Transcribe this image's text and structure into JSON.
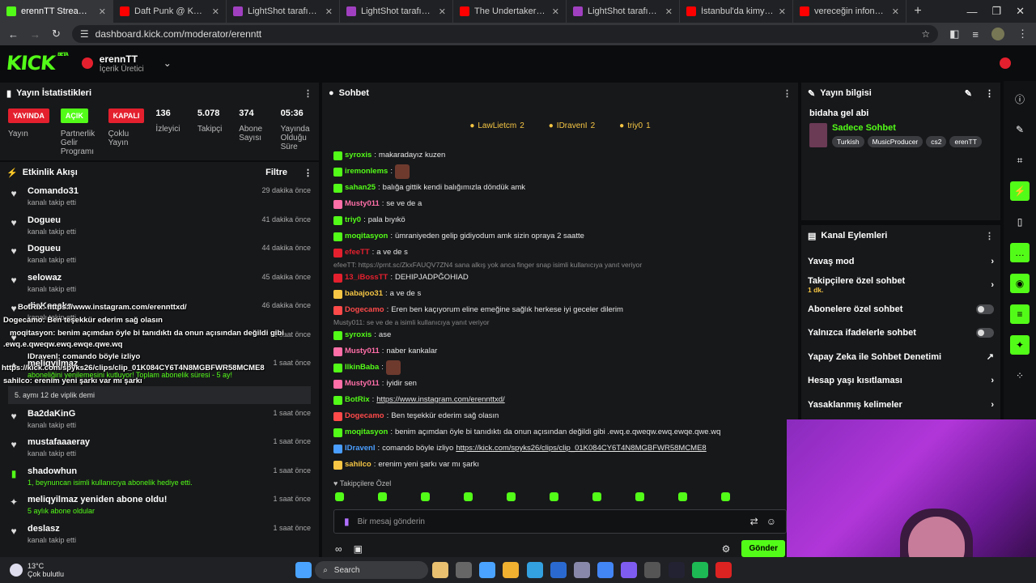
{
  "browser": {
    "tabs": [
      {
        "title": "erennTT Stream - Kick Da",
        "color": "#53fc18",
        "active": true
      },
      {
        "title": "Daft Punk @ Kuruçeşme A",
        "color": "#ff0000"
      },
      {
        "title": "LightShot tarafından Ekra",
        "color": "#a040c0"
      },
      {
        "title": "LightShot tarafından Ekra",
        "color": "#a040c0"
      },
      {
        "title": "The Undertaker appears f",
        "color": "#ff0000"
      },
      {
        "title": "LightShot tarafından Ekra",
        "color": "#a040c0"
      },
      {
        "title": "İstanbul'da kimyasal mad",
        "color": "#ff0000"
      },
      {
        "title": "vereceğin infonun ta a*m",
        "color": "#ff0000"
      }
    ],
    "url": "dashboard.kick.com/moderator/erenntt"
  },
  "header": {
    "logo": "KICK",
    "logo_sup": "BETA",
    "channel": "erennTT",
    "role": "İçerik Üretici"
  },
  "stats": {
    "title": "Yayın İstatistikleri",
    "items": [
      {
        "badge": "YAYINDA",
        "badge_color": "#e4202e",
        "label": "Yayın"
      },
      {
        "badge": "AÇIK",
        "badge_color": "#53fc18",
        "label": "Partnerlik Gelir Programı"
      },
      {
        "badge": "KAPALI",
        "badge_color": "#e4202e",
        "label": "Çoklu Yayın"
      },
      {
        "value": "136",
        "label": "İzleyici"
      },
      {
        "value": "5.078",
        "label": "Takipçi"
      },
      {
        "value": "374",
        "label": "Abone Sayısı"
      },
      {
        "value": "05:36",
        "label": "Yayında Olduğu Süre"
      }
    ]
  },
  "feed": {
    "title": "Etkinlik Akışı",
    "filter": "Filtre",
    "items": [
      {
        "name": "Comando31",
        "sub": "kanalı takip etti",
        "time": "29 dakika önce",
        "icon": "heart"
      },
      {
        "name": "Dogueu",
        "sub": "kanalı takip etti",
        "time": "41 dakika önce",
        "icon": "heart"
      },
      {
        "name": "Dogueu",
        "sub": "kanalı takip etti",
        "time": "44 dakika önce",
        "icon": "heart"
      },
      {
        "name": "selowaz",
        "sub": "kanalı takip etti",
        "time": "45 dakika önce",
        "icon": "heart"
      },
      {
        "name": "dieKocaks",
        "sub": "kanalı takip etti",
        "time": "46 dakika önce",
        "icon": "heart"
      },
      {
        "name": "",
        "sub": "",
        "time": "1 saat önce",
        "icon": "heart"
      },
      {
        "name": "meliqyilmaz",
        "sub": "aboneliğini yenilemesini kutluyor! Toplam abonelik süresi - 5 ay!",
        "time": "1 saat önce",
        "icon": "star"
      },
      {
        "name": "Ba2daKinG",
        "sub": "kanalı takip etti",
        "time": "1 saat önce",
        "icon": "heart"
      },
      {
        "name": "mustafaaaeray",
        "sub": "kanalı takip etti",
        "time": "1 saat önce",
        "icon": "heart"
      },
      {
        "name": "shadowhun",
        "sub": "1, beynuncan isimli kullanıcıya abonelik hediye etti.",
        "time": "1 saat önce",
        "icon": "gift"
      },
      {
        "name": "meliqyilmaz yeniden abone oldu!",
        "sub": "5 aylık abone oldular",
        "time": "1 saat önce",
        "icon": "star"
      },
      {
        "name": "deslasz",
        "sub": "kanalı takip etti",
        "time": "1 saat önce",
        "icon": "heart"
      }
    ],
    "gift_msg": "5. aymı 12 de viplik demi"
  },
  "overlay": [
    {
      "text": "BotRix: https://www.instagram.com/erennttxd/",
      "color": "#ffffff"
    },
    {
      "text": "Dogecamo: Ben teşekkür ederim sağ olasın",
      "color": "#ffffff"
    },
    {
      "text": "moqitasyon: benim açımdan öyle bi tanıdıktı da onun açısından değildi gibi",
      "color": "#ffffff"
    },
    {
      "text": ".ewq.e.qweqw.ewq.ewqe.qwe.wq",
      "color": "#ffffff"
    },
    {
      "text": "IDravenI: comando böyle izliyo",
      "color": "#ffffff"
    },
    {
      "text": "https://kick.com/spyks26/clips/clip_01K084CY6T4N8MGBFWR58MCME8",
      "color": "#ffffff"
    },
    {
      "text": "sahilco: erenim yeni şarkı var mı şarkı",
      "color": "#ffffff"
    }
  ],
  "chat": {
    "title": "Sohbet",
    "top": [
      {
        "name": "LawLietcm",
        "count": "2"
      },
      {
        "name": "IDravenI",
        "count": "2"
      },
      {
        "name": "triy0",
        "count": "1"
      }
    ],
    "messages": [
      {
        "user": "syroxis",
        "color": "#53fc18",
        "text": "makaradayız kuzen"
      },
      {
        "user": "iremonlems",
        "color": "#53fc18",
        "text": "",
        "emote": true
      },
      {
        "user": "sahan25",
        "color": "#53fc18",
        "text": "balığa gittik kendi balığımızla döndük amk"
      },
      {
        "user": "Musty011",
        "color": "#ff6fa8",
        "text": "se ve de a"
      },
      {
        "user": "triy0",
        "color": "#53fc18",
        "text": "pala bıyıkö"
      },
      {
        "user": "moqitasyon",
        "color": "#53fc18",
        "text": "ümraniyeden gelip gidiyodum amk sizin opraya 2 saatte"
      },
      {
        "user": "efeeTT",
        "color": "#e4202e",
        "text": "a ve de s"
      },
      {
        "reply": "efeeTT: https://prnt.sc/ZkxFAUQV7ZN4 sana alkış yok anca finger snap isimli kullanıcıya yanıt veriyor"
      },
      {
        "user": "13_iBossTT",
        "color": "#e4202e",
        "text": "DEHIPJADPĞOHIAD"
      },
      {
        "user": "babajoo31",
        "color": "#f6c644",
        "text": "a ve de s"
      },
      {
        "user": "Dogecamo",
        "color": "#ff4a4a",
        "text": "Eren ben kaçıyorum eline emeğine sağlık herkese iyi geceler dilerim"
      },
      {
        "reply": "Musty011: se ve de a isimli kullanıcıya yanıt veriyor"
      },
      {
        "user": "syroxis",
        "color": "#53fc18",
        "text": "ase"
      },
      {
        "user": "Musty011",
        "color": "#ff6fa8",
        "text": "naber kankalar"
      },
      {
        "user": "IlkinBaba",
        "color": "#53fc18",
        "text": "",
        "emote": true
      },
      {
        "user": "Musty011",
        "color": "#ff6fa8",
        "text": "iyidir sen"
      },
      {
        "user": "BotRix",
        "color": "#53fc18",
        "text": "",
        "link": "https://www.instagram.com/erennttxd/"
      },
      {
        "user": "Dogecamo",
        "color": "#ff4a4a",
        "text": "Ben teşekkür ederim sağ olasın"
      },
      {
        "user": "moqitasyon",
        "color": "#53fc18",
        "text": "benim açımdan öyle bi tanıdıktı da onun açısından değildi gibi .ewq.e.qweqw.ewq.ewqe.qwe.wq"
      },
      {
        "user": "IDravenI",
        "color": "#4a9eff",
        "text": "comando böyle izliyo",
        "link": "https://kick.com/spyks26/clips/clip_01K084CY6T4N8MGBFWR58MCME8"
      },
      {
        "user": "sahilco",
        "color": "#f6c644",
        "text": "erenim yeni şarkı var mı şarkı"
      }
    ],
    "followers_only": "Takipçilere Özel",
    "placeholder": "Bir mesaj gönderin",
    "send": "Gönder"
  },
  "stream_info": {
    "title": "Yayın bilgisi",
    "stream_title": "bidaha gel abi",
    "category": "Sadece Sohbet",
    "tags": [
      "Turkish",
      "MusicProducer",
      "cs2",
      "erenTT"
    ]
  },
  "channel_actions": {
    "title": "Kanal Eylemleri",
    "items": [
      {
        "label": "Yavaş mod",
        "type": "arrow"
      },
      {
        "label": "Takipçilere özel sohbet",
        "sub": "1 dk.",
        "type": "arrow"
      },
      {
        "label": "Abonelere özel sohbet",
        "type": "toggle"
      },
      {
        "label": "Yalnızca ifadelerle sohbet",
        "type": "toggle"
      },
      {
        "label": "Yapay Zeka ile Sohbet Denetimi",
        "type": "ext"
      },
      {
        "label": "Hesap yaşı kısıtlaması",
        "type": "arrow"
      },
      {
        "label": "Yasaklanmış kelimeler",
        "type": "arrow"
      }
    ]
  },
  "taskbar": {
    "temp": "13°C",
    "weather": "Çok bulutlu",
    "search": "Search"
  }
}
